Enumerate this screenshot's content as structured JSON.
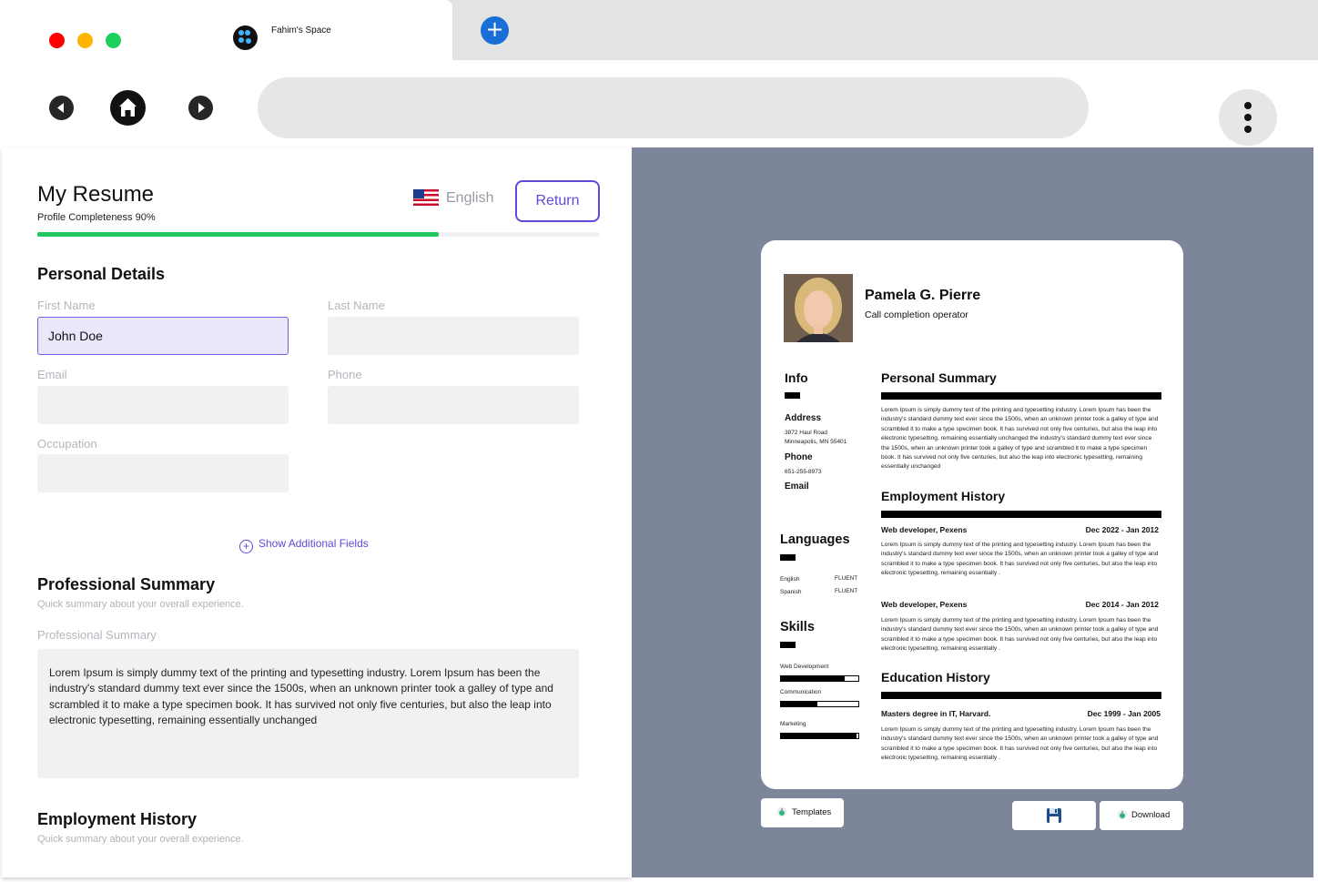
{
  "browser": {
    "tab_title": "Fahim's Space",
    "new_tab_symbol": "+",
    "traffic_colors": [
      "#ff0000",
      "#ffb400",
      "#1bd15a"
    ]
  },
  "editor": {
    "title": "My Resume",
    "completeness_label": "Profile Completeness 90%",
    "completeness_fraction": 0.9,
    "language": "English",
    "return_label": "Return",
    "accent_color": "#5b4bd6",
    "progress_color": "#22c55e",
    "personal_details": {
      "heading": "Personal Details",
      "first_name_label": "First Name",
      "first_name_value": "John Doe",
      "last_name_label": "Last Name",
      "email_label": "Email",
      "phone_label": "Phone",
      "occupation_label": "Occupation"
    },
    "show_additional_fields": "Show Additional Fields",
    "professional_summary": {
      "heading": "Professional Summary",
      "subtitle": "Quick summary about your overall experience.",
      "field_label": "Professional Summary",
      "text": "Lorem Ipsum is simply dummy text of the printing and typesetting industry. Lorem Ipsum has been the industry's standard dummy text ever since the 1500s, when an unknown printer took a galley of type and scrambled it to make a type specimen book. It has survived not only five centuries, but also the leap into electronic typesetting, remaining essentially unchanged"
    },
    "employment_history": {
      "heading": "Employment History",
      "subtitle": "Quick summary about your overall experience."
    }
  },
  "preview": {
    "panel_color": "#7c8599",
    "name": "Pamela G. Pierre",
    "job_title": "Call completion operator",
    "info": {
      "heading": "Info",
      "address_label": "Address",
      "address_line1": "3872 Haul Road",
      "address_line2": "Minneapolis, MN 55401",
      "phone_label": "Phone",
      "phone_value": "651-255-8973",
      "email_label": "Email"
    },
    "languages": {
      "heading": "Languages",
      "items": [
        {
          "name": "English",
          "level": "FLUENT"
        },
        {
          "name": "Spanish",
          "level": "FLUENT"
        }
      ]
    },
    "skills": {
      "heading": "Skills",
      "items": [
        {
          "name": "Web Development",
          "level": 0.82
        },
        {
          "name": "Communication",
          "level": 0.47
        },
        {
          "name": "Marketing",
          "level": 0.98
        }
      ]
    },
    "personal_summary": {
      "heading": "Personal Summary",
      "text": "Lorem Ipsum is simply dummy text of the printing and typesetting industry. Lorem Ipsum has been the industry's standard dummy text ever since the 1500s, when an unknown printer took a galley of type and scrambled it to make a type specimen book. It has survived not only five centuries, but also the leap into electronic typesetting, remaining essentially unchanged the industry's standard dummy text ever since the 1500s, when an unknown printer took a galley of type and scrambled it to make a type specimen book. It has survived not only five centuries, but also the leap into electronic typesetting, remaining essentially unchanged"
    },
    "employment_history": {
      "heading": "Employment History",
      "jobs": [
        {
          "title": "Web developer, Pexens",
          "dates": "Dec 2022 - Jan 2012",
          "text": "Lorem Ipsum is simply dummy text of the printing and typesetting industry. Lorem Ipsum has been the industry's standard dummy text ever since the 1500s, when an unknown printer took a galley of type and scrambled it to make a type specimen book. It has survived not only five centuries, but also the leap into electronic typesetting, remaining essentially ."
        },
        {
          "title": "Web developer, Pexens",
          "dates": "Dec 2014 - Jan 2012",
          "text": "Lorem Ipsum is simply dummy text of the printing and typesetting industry. Lorem Ipsum has been the industry's standard dummy text ever since the 1500s, when an unknown printer took a galley of type and scrambled it to make a type specimen book. It has survived not only five centuries, but also the leap into electronic typesetting, remaining essentially ."
        }
      ]
    },
    "education_history": {
      "heading": "Education History",
      "items": [
        {
          "title": "Masters degree in IT, Harvard.",
          "dates": "Dec 1999 - Jan 2005",
          "text": "Lorem Ipsum is simply dummy text of the printing and typesetting industry. Lorem Ipsum has been the industry's standard dummy text ever since the 1500s, when an unknown printer took a galley of type and scrambled it to make a type specimen book. It has survived not only five centuries, but also the leap into electronic typesetting, remaining essentially ."
        }
      ]
    },
    "buttons": {
      "templates_label": "Templates",
      "download_label": "Download",
      "save_icon": "floppy-disk-icon"
    }
  }
}
